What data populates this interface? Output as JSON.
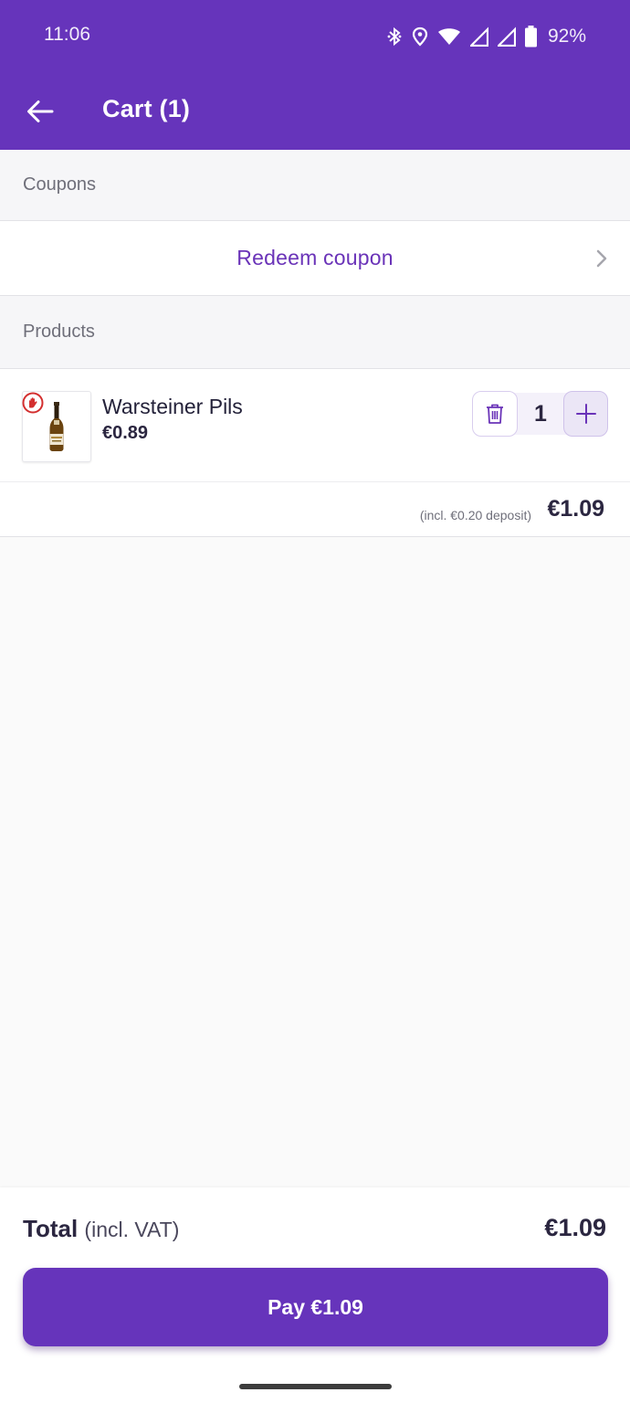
{
  "status_bar": {
    "time": "11:06",
    "battery": "92%",
    "icons": [
      "bluetooth-icon",
      "location-icon",
      "wifi-icon",
      "signal-icon",
      "signal-icon",
      "battery-icon"
    ]
  },
  "header": {
    "title": "Cart (1)",
    "back_icon": "arrow-left-icon",
    "background_color": "#6634bb"
  },
  "coupons_section": {
    "title": "Coupons",
    "redeem_label": "Redeem coupon",
    "chevron_icon": "chevron-right-icon"
  },
  "products_section": {
    "title": "Products",
    "items": [
      {
        "name": "Warsteiner Pils",
        "price": "€0.89",
        "quantity": "1",
        "badge_icon": "age-restriction-hand-icon",
        "delete_icon": "trash-icon",
        "increment_icon": "plus-icon",
        "deposit_note": "(incl. €0.20 deposit)",
        "line_total": "€1.09"
      }
    ]
  },
  "footer": {
    "total_label": "Total",
    "total_sublabel": "(incl. VAT)",
    "total_amount": "€1.09",
    "pay_label": "Pay €1.09"
  },
  "colors": {
    "accent": "#6634bb",
    "link": "#6a33b8",
    "text_dark": "#2b2640",
    "muted": "#6f6f7a",
    "badge_red": "#d32f2f"
  }
}
